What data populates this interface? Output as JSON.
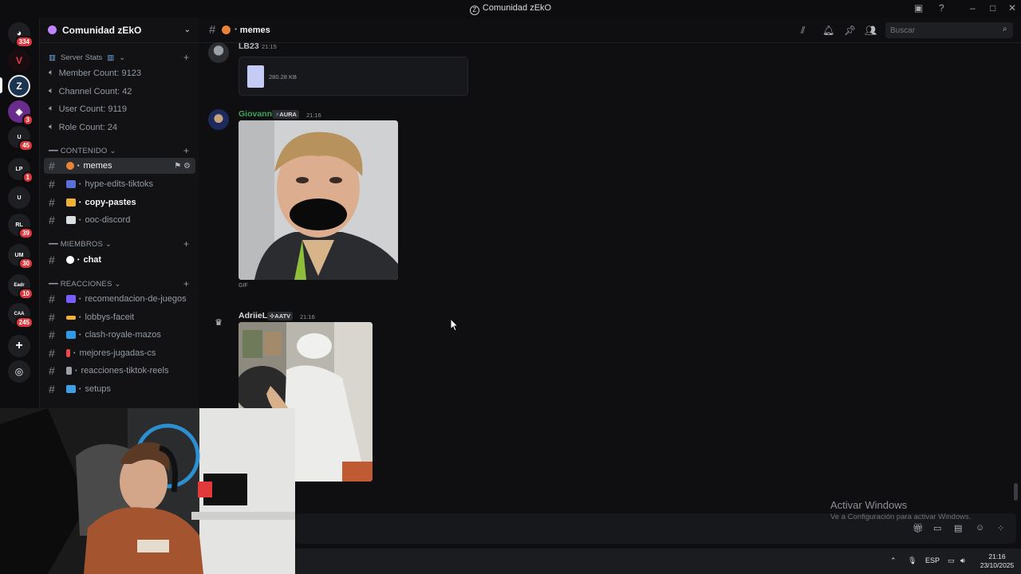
{
  "window": {
    "title": "Comunidad zEkO",
    "logo_letter": "Z"
  },
  "server_list": {
    "badges": {
      "dm": "334",
      "s3": "3",
      "s4": "45",
      "s5": "1",
      "s7": "39",
      "s8": "30",
      "s9": "10",
      "s10": "245"
    },
    "folder_labels": {
      "s4a": "U",
      "s4b": "CAT",
      "s5": "LP",
      "s6": "U",
      "s7": "RL",
      "s8": "UM",
      "s9": "Eadr",
      "s10a": "CAA",
      "s10b": "Ca"
    }
  },
  "sidebar": {
    "guild_name": "Comunidad zEkO",
    "server_stats": {
      "title": "Server Stats",
      "items": [
        "Member Count: 9123",
        "Channel Count: 42",
        "User Count: 9119",
        "Role Count: 24"
      ]
    },
    "categories": [
      {
        "name": "CONTENIDO"
      },
      {
        "name": "MIEMBROS"
      },
      {
        "name": "REACCIONES"
      }
    ],
    "channels": [
      {
        "name": "memes",
        "color": "#e8833a",
        "active": true
      },
      {
        "name": "hype-edits-tiktoks",
        "color": "#5b6fd8"
      },
      {
        "name": "copy-pastes",
        "color": "#f0b232",
        "unread": true
      },
      {
        "name": "ooc-discord",
        "color": "#dbdee1"
      },
      {
        "name": "chat",
        "color": "#ffffff",
        "unread": true
      },
      {
        "name": "recomendacion-de-juegos",
        "color": "#7b5cff"
      },
      {
        "name": "lobbys-faceit",
        "color": "#f0b232"
      },
      {
        "name": "clash-royale-mazos",
        "color": "#2f9be8"
      },
      {
        "name": "mejores-jugadas-cs",
        "color": "#e84a4a"
      },
      {
        "name": "reacciones-tiktok-reels",
        "color": "#9aa0a6"
      },
      {
        "name": "setups",
        "color": "#3ea0e4"
      }
    ]
  },
  "channel_header": {
    "name": "memes",
    "search_placeholder": "Buscar"
  },
  "messages": [
    {
      "author": "LB23",
      "time": "21:15",
      "file_size": "280.28 KB",
      "color": "#b5bac1"
    },
    {
      "author": "Giovanni",
      "tag": "AURA",
      "time": "21:16",
      "attachment_label": "GIF",
      "color": "#3ba55c"
    },
    {
      "author": "AdriieL",
      "tag": "AATV",
      "time": "21:16",
      "color": "#dbdee1"
    }
  ],
  "watermark": {
    "line1": "Activar Windows",
    "line2": "Ve a Configuración para activar Windows."
  },
  "taskbar": {
    "language": "ESP",
    "time": "21:16",
    "date": "23/10/2025"
  }
}
